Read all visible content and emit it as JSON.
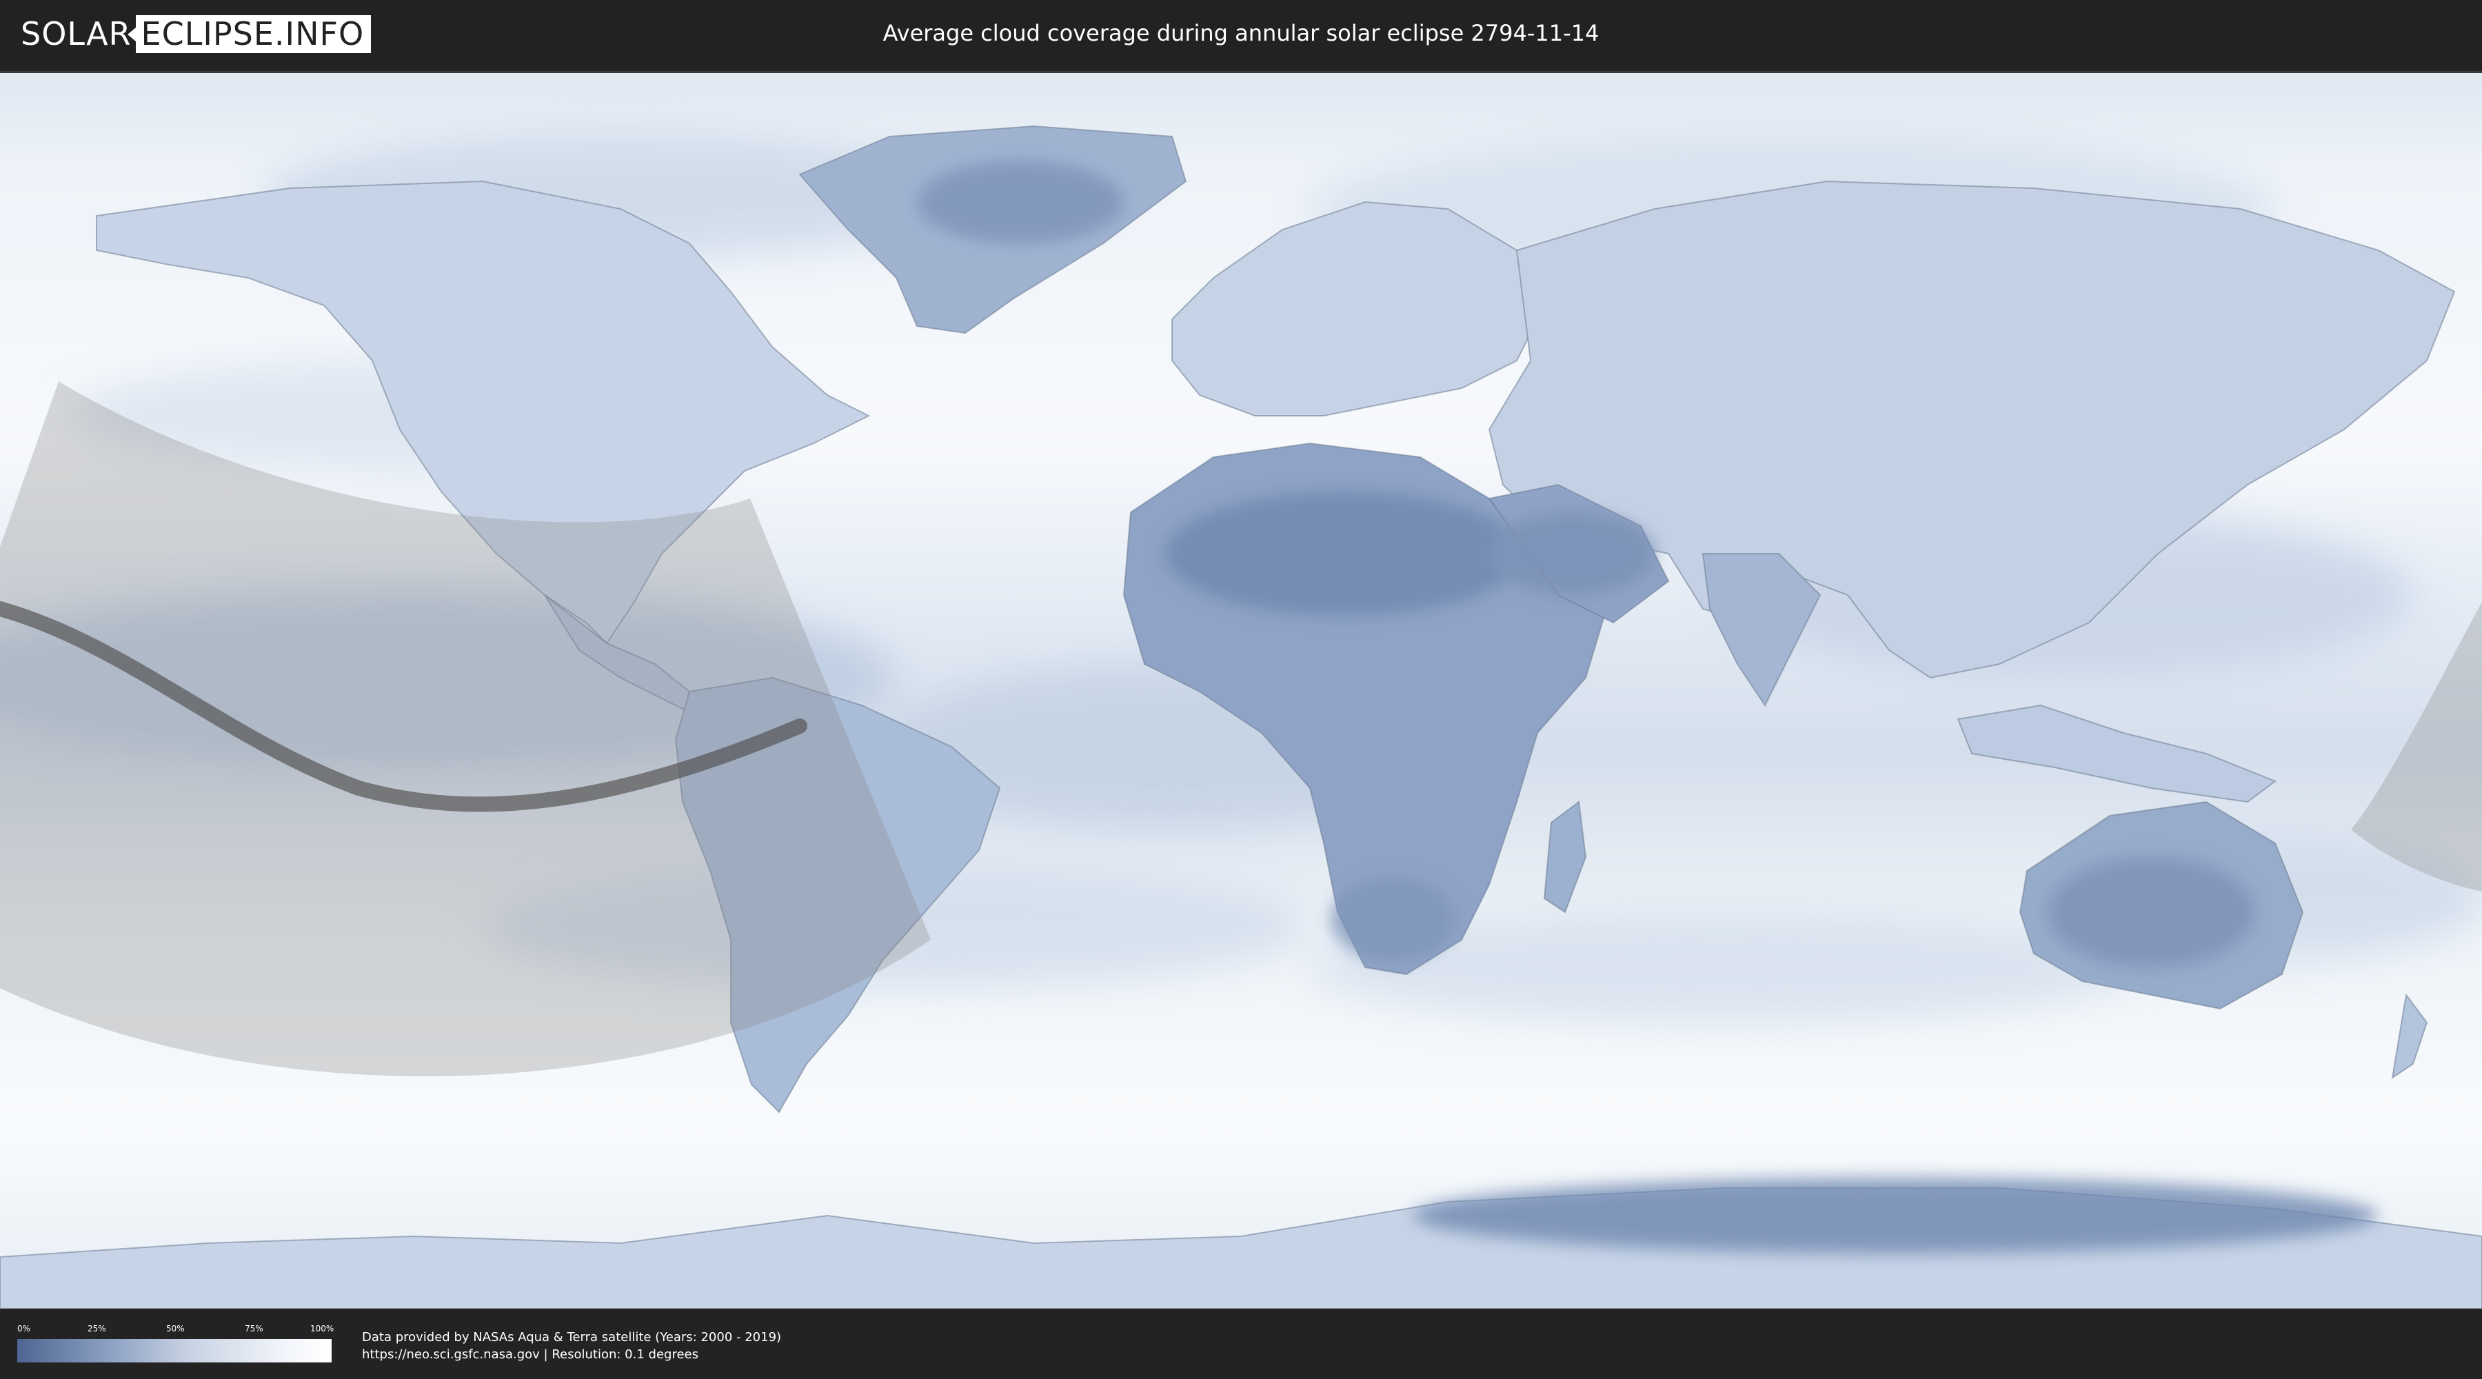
{
  "header": {
    "logo_left": "SOLAR",
    "logo_right": "ECLIPSE.INFO",
    "title": "Average cloud coverage during annular solar eclipse 2794-11-14"
  },
  "map": {
    "colors": {
      "ocean_clear": "#ffffff",
      "cloud_light": "#e8eef6",
      "cloud_mid": "#b9c8de",
      "cloud_dark": "#5f79a3",
      "eclipse_zone": "#8c8c8c",
      "central_path": "#555555",
      "coastline": "#6b7a8f"
    },
    "icons": {
      "eclipse_visibility_zone": "shaded-region",
      "central_line": "path-line"
    }
  },
  "legend": {
    "ticks": [
      "0%",
      "25%",
      "50%",
      "75%",
      "100%"
    ],
    "color_from": "#4d6591",
    "color_to": "#ffffff"
  },
  "footer": {
    "credit_line": "Data provided by NASAs Aqua & Terra satellite (Years: 2000 - 2019)",
    "source_line": "https://neo.sci.gsfc.nasa.gov | Resolution: 0.1 degrees"
  }
}
